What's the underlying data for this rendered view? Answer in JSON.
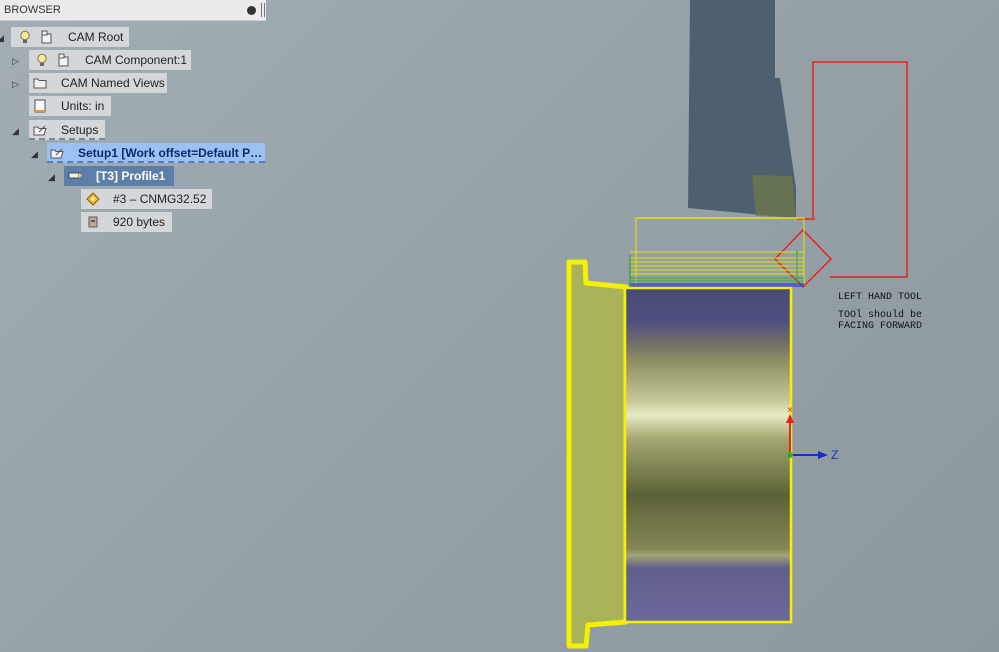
{
  "browser": {
    "title": "BROWSER",
    "nodes": {
      "cam_root": "CAM Root",
      "cam_component": "CAM Component:1",
      "named_views": "CAM Named Views",
      "units": "Units: in",
      "setups": "Setups",
      "setup1": "Setup1 [Work offset=Default P…",
      "profile": "[T3] Profile1",
      "tool": "#3 – CNMG32.52",
      "size": "920 bytes"
    }
  },
  "annotation": {
    "line1": "LEFT HAND TOOL",
    "line2": "TOOl should be",
    "line3": "FACING FORWARD"
  },
  "axes": {
    "z_label": "Z",
    "x_label": "X"
  },
  "colors": {
    "stock_outline": "#f5ef00",
    "tool_outline": "#e8241a",
    "axis_z": "#1a2ccc",
    "axis_x": "#e8241a",
    "selection": "#9cc0f2",
    "profile": "#5b7fa8"
  },
  "icons": {
    "light_bulb": "light-bulb-icon",
    "component": "component-icon",
    "folder": "folder-icon",
    "document": "units-document-icon",
    "setups": "setups-icon",
    "turning_tool": "turning-tool-icon",
    "insert": "insert-icon",
    "file": "file-size-icon"
  }
}
